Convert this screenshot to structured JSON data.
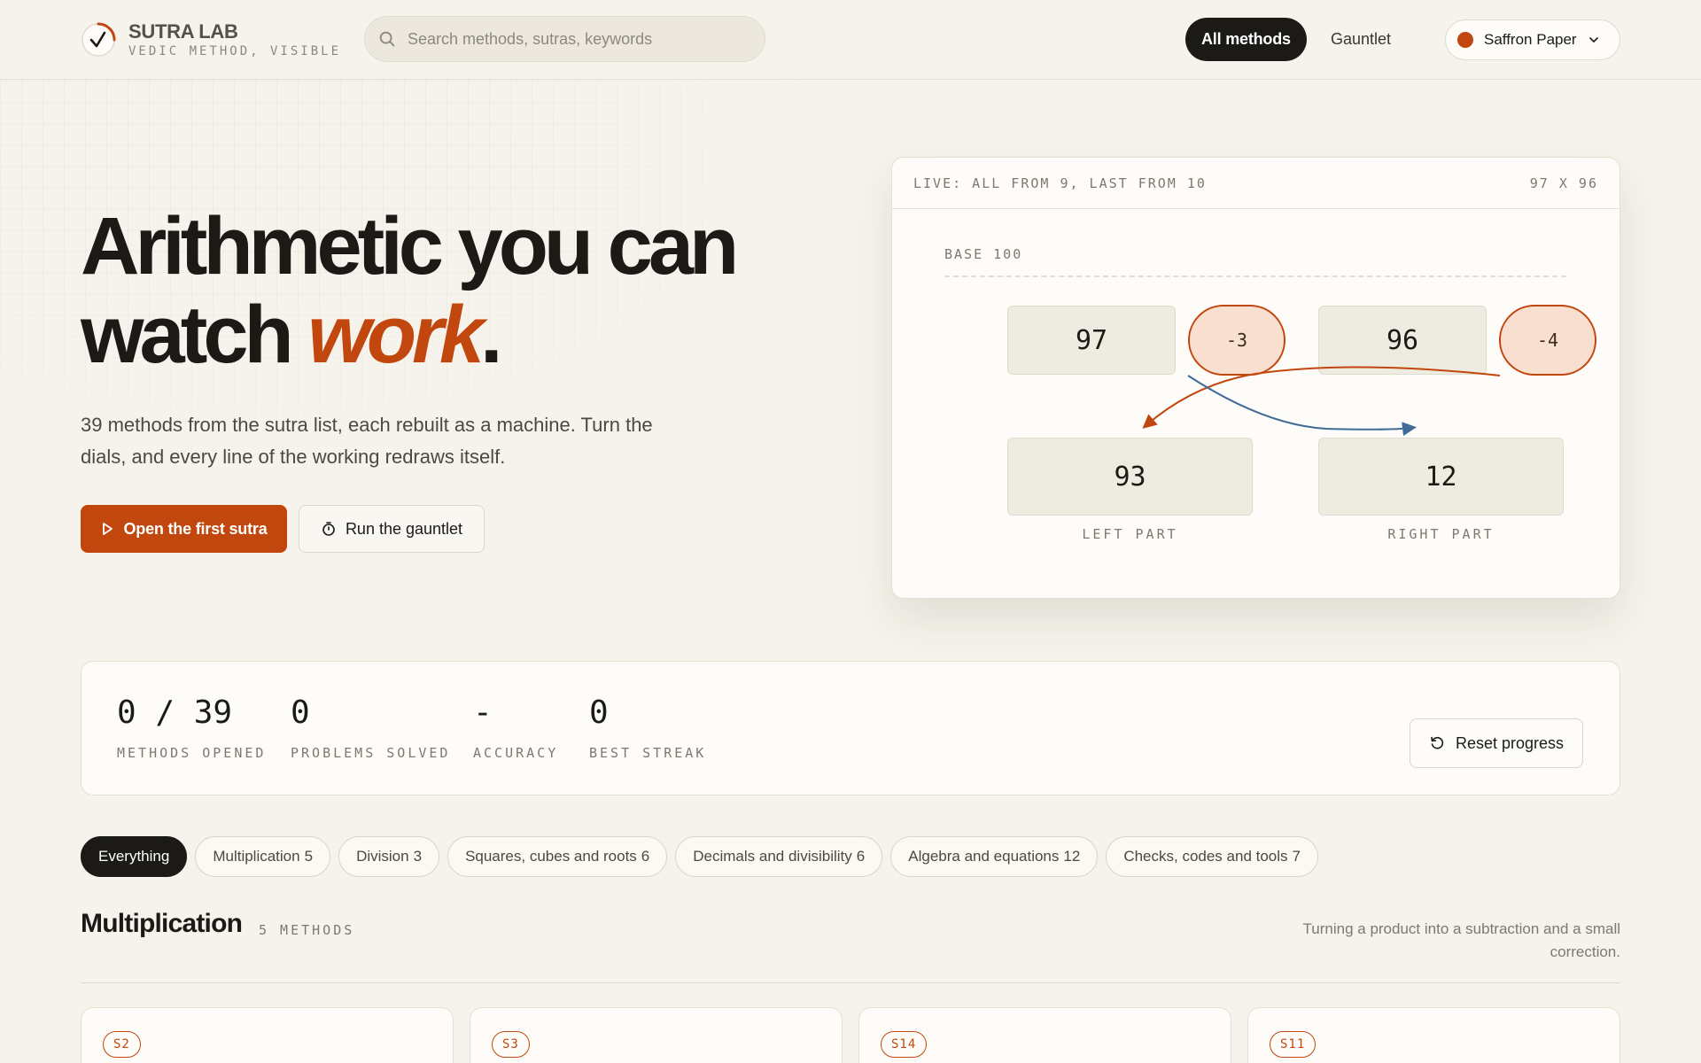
{
  "brand": {
    "title": "SUTRA LAB",
    "subtitle": "VEDIC METHOD, VISIBLE"
  },
  "search": {
    "placeholder": "Search methods, sutras, keywords"
  },
  "nav": {
    "all_methods": "All methods",
    "gauntlet": "Gauntlet"
  },
  "theme": {
    "label": "Saffron Paper",
    "color": "#c2470e"
  },
  "hero": {
    "title_line1": "Arithmetic you can",
    "title_line2_a": "watch ",
    "title_line2_accent": "work",
    "title_line2_end": ".",
    "description": "39 methods from the sutra list, each rebuilt as a machine. Turn the dials, and every line of the working redraws itself.",
    "primary_button": "Open the first sutra",
    "secondary_button": "Run the gauntlet"
  },
  "demo": {
    "live_label": "LIVE: ALL FROM 9, LAST FROM 10",
    "problem": "97 X 96",
    "base_label": "BASE 100",
    "a": "97",
    "a_deviation": "-3",
    "b": "96",
    "b_deviation": "-4",
    "left_value": "93",
    "right_value": "12",
    "left_label": "LEFT PART",
    "right_label": "RIGHT PART"
  },
  "stats": {
    "methods_opened": {
      "value": "0 / 39",
      "label": "METHODS OPENED"
    },
    "problems_solved": {
      "value": "0",
      "label": "PROBLEMS SOLVED"
    },
    "accuracy": {
      "value": "-",
      "label": "ACCURACY"
    },
    "best_streak": {
      "value": "0",
      "label": "BEST STREAK"
    },
    "reset_button": "Reset progress"
  },
  "filters": [
    {
      "label": "Everything",
      "count": "",
      "active": true
    },
    {
      "label": "Multiplication",
      "count": "5",
      "active": false
    },
    {
      "label": "Division",
      "count": "3",
      "active": false
    },
    {
      "label": "Squares, cubes and roots",
      "count": "6",
      "active": false
    },
    {
      "label": "Decimals and divisibility",
      "count": "6",
      "active": false
    },
    {
      "label": "Algebra and equations",
      "count": "12",
      "active": false
    },
    {
      "label": "Checks, codes and tools",
      "count": "7",
      "active": false
    }
  ],
  "section": {
    "title": "Multiplication",
    "count": "5 METHODS",
    "description": "Turning a product into a subtraction and a small correction."
  },
  "method_cards": [
    {
      "tag": "S2"
    },
    {
      "tag": "S3"
    },
    {
      "tag": "S14"
    },
    {
      "tag": "S11"
    }
  ],
  "colors": {
    "accent": "#c2470e",
    "background": "#f6f3ec",
    "ink": "#1b1a17",
    "arrow_blue": "#3f6b96"
  }
}
